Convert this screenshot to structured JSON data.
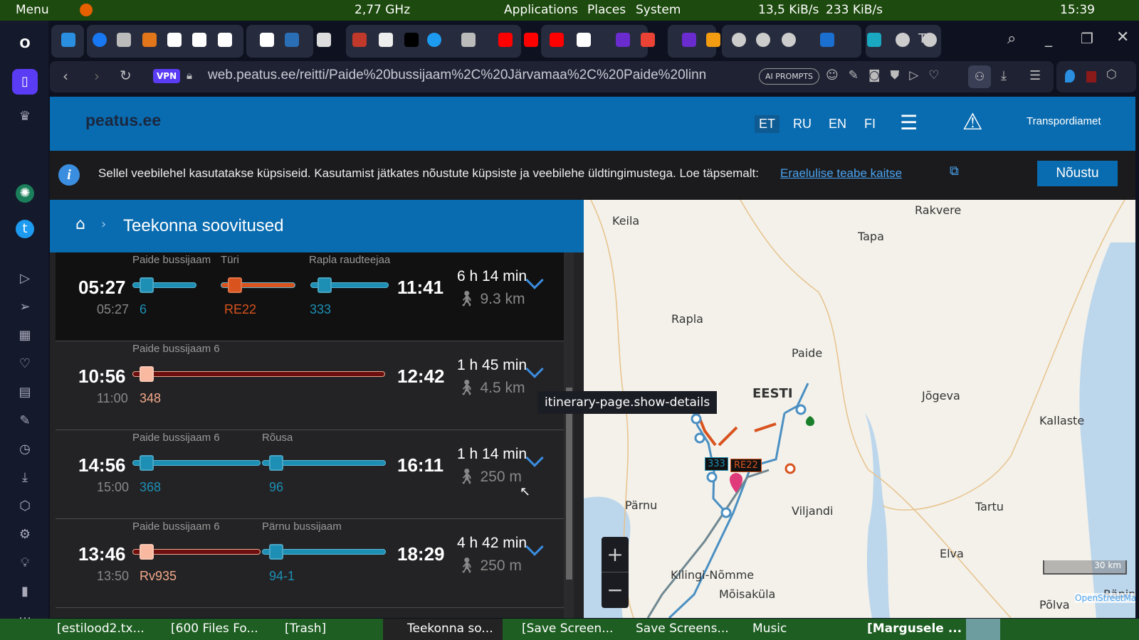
{
  "system_panel": {
    "menu": "Menu",
    "cpu": "2,77 GHz",
    "applications": "Applications",
    "places": "Places",
    "system": "System",
    "net_down": "13,5 KiB/s",
    "net_up": "233 KiB/s",
    "clock": "15:39"
  },
  "browser": {
    "tab_icons": [
      "vpn-pin",
      "facebook",
      "bank",
      "fox",
      "google",
      "google",
      "google",
      "google",
      "rt",
      "emi",
      "opera-red",
      "wikipedia",
      "medium",
      "twitter",
      "bank",
      "youtube",
      "youtube",
      "youtube",
      "google",
      "mail-purple",
      "gmail",
      "mail-purple",
      "orange-app",
      "globe",
      "globe",
      "globe",
      "peatus",
      "te",
      "cloud",
      "globe",
      "plus"
    ],
    "active_tab_text": "Te",
    "url": "web.peatus.ee/reitti/Paide%20bussijaam%2C%20Järvamaa%2C%20Paide%20linn",
    "vpn": "VPN",
    "ai_prompts": "AI PROMPTS"
  },
  "site": {
    "logo": "peatus.ee",
    "languages": [
      "ET",
      "RU",
      "EN",
      "FI"
    ],
    "active_language": "ET",
    "transport_link": "Transpordiamet"
  },
  "cookie": {
    "text": "Sellel veebilehel kasutatakse küpsiseid. Kasutamist jätkates nõustute küpsiste ja veebilehe üldtingimustega. Loe täpsemalt:",
    "link": "Eraelulise teabe kaitse",
    "accept": "Nõustu"
  },
  "itinerary": {
    "title": "Teekonna soovitused",
    "rows": [
      {
        "dep": "05:27",
        "sched": "05:27",
        "arr": "11:41",
        "duration": "6 h 14 min",
        "walk": "9.3 km",
        "stops": [
          "Paide bussijaam",
          "Türi",
          "Rapla raudteejaam"
        ],
        "routes": [
          "6",
          "RE22",
          "333"
        ]
      },
      {
        "dep": "10:56",
        "sched": "11:00",
        "arr": "12:42",
        "duration": "1 h 45 min",
        "walk": "4.5 km",
        "stops": [
          "Paide bussijaam 6"
        ],
        "routes": [
          "348"
        ]
      },
      {
        "dep": "14:56",
        "sched": "15:00",
        "arr": "16:11",
        "duration": "1 h 14 min",
        "walk": "250 m",
        "stops": [
          "Paide bussijaam 6",
          "Rõusa"
        ],
        "routes": [
          "368",
          "96"
        ]
      },
      {
        "dep": "13:46",
        "sched": "13:50",
        "arr": "18:29",
        "duration": "4 h 42 min",
        "walk": "250 m",
        "stops": [
          "Paide bussijaam 6",
          "Pärnu bussijaam"
        ],
        "routes": [
          "Rv935",
          "94-1"
        ]
      }
    ],
    "tooltip": "itinerary-page.show-details"
  },
  "map": {
    "places": [
      "Keila",
      "Rakvere",
      "Tapa",
      "Rapla",
      "Paide",
      "EESTI",
      "Jõgeva",
      "Kallaste",
      "Pärnu",
      "Viljandi",
      "Tartu",
      "Elva",
      "Kilingi-Nõmme",
      "Mõisaküla",
      "Räpina",
      "Põlva"
    ],
    "route_labels": [
      "333",
      "RE22"
    ],
    "scale": "30 km",
    "attribution": "OpenStreetMap",
    "zoom_in": "+",
    "zoom_out": "−"
  },
  "taskbar": {
    "items": [
      "[estilood2.tx...",
      "[600 Files Fo...",
      "[Trash]",
      "Teekonna so...",
      "[Save Screen...",
      "Save Screens...",
      "Music",
      "[Margusele ..."
    ]
  },
  "colors": {
    "bus": "#1d8fb5",
    "train": "#d9531e",
    "night": "#6d0f0f",
    "brand": "#0a6cb0"
  }
}
